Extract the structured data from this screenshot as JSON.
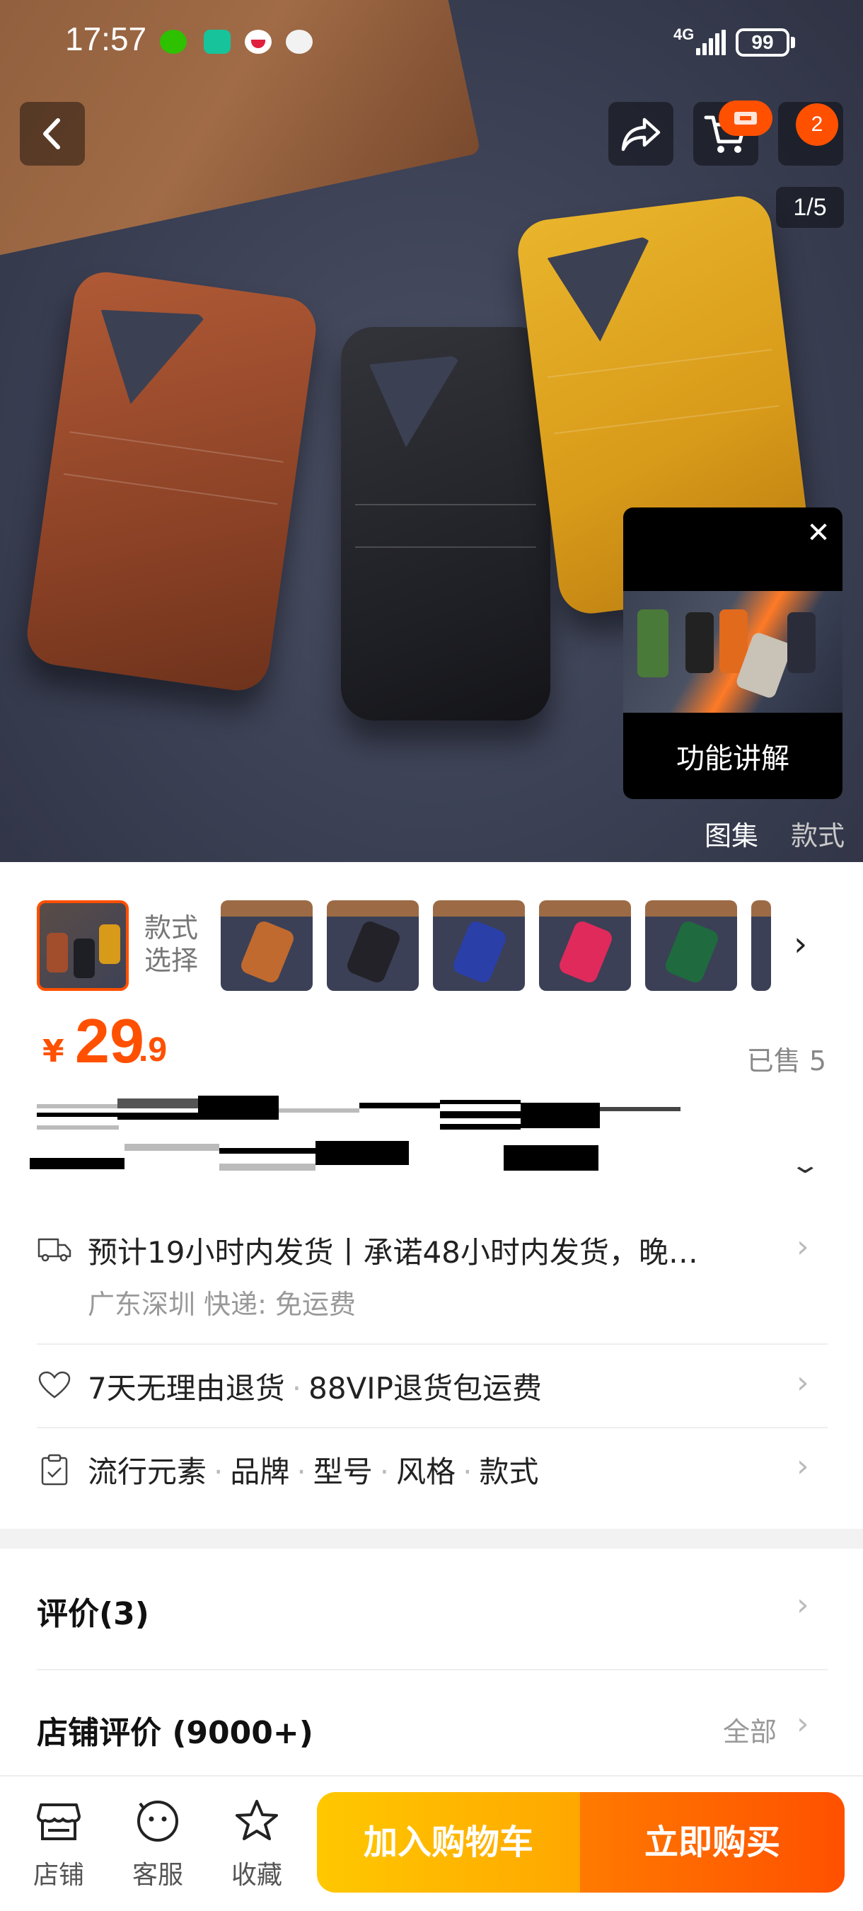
{
  "status_bar": {
    "time": "17:57",
    "network": "4G",
    "battery": "99"
  },
  "hero": {
    "page_indicator": "1/5",
    "cart_badge_count": "",
    "more_badge_count": "2",
    "video_popup_label": "功能讲解",
    "gallery_tabs": [
      "图集",
      "款式"
    ]
  },
  "style_selector": {
    "label_line1": "款式",
    "label_line2": "选择",
    "thumb_colors": [
      "#c06a2f",
      "#222228",
      "#2a3fa8",
      "#e02a5c",
      "#1f6a3e"
    ]
  },
  "price": {
    "currency": "¥",
    "integer": "29",
    "decimal": ".9",
    "sold": "已售 5"
  },
  "info_rows": {
    "shipping_main": "预计19小时内发货丨承诺48小时内发货，晚…",
    "shipping_sub": "广东深圳  快递: 免运费",
    "return_part1": "7天无理由退货",
    "return_part2": "88VIP退货包运费",
    "params": [
      "流行元素",
      "品牌",
      "型号",
      "风格",
      "款式"
    ]
  },
  "reviews": {
    "title": "评价(3)"
  },
  "shop_reviews": {
    "title": "店铺评价 (9000+)",
    "all_label": "全部"
  },
  "bottom_bar": {
    "shop_label": "店铺",
    "service_label": "客服",
    "favorite_label": "收藏",
    "add_to_cart_label": "加入购物车",
    "buy_now_label": "立即购买"
  },
  "colors": {
    "accent": "#ff5000",
    "cart_button": "#ffb300",
    "buy_button": "#ff6200"
  }
}
